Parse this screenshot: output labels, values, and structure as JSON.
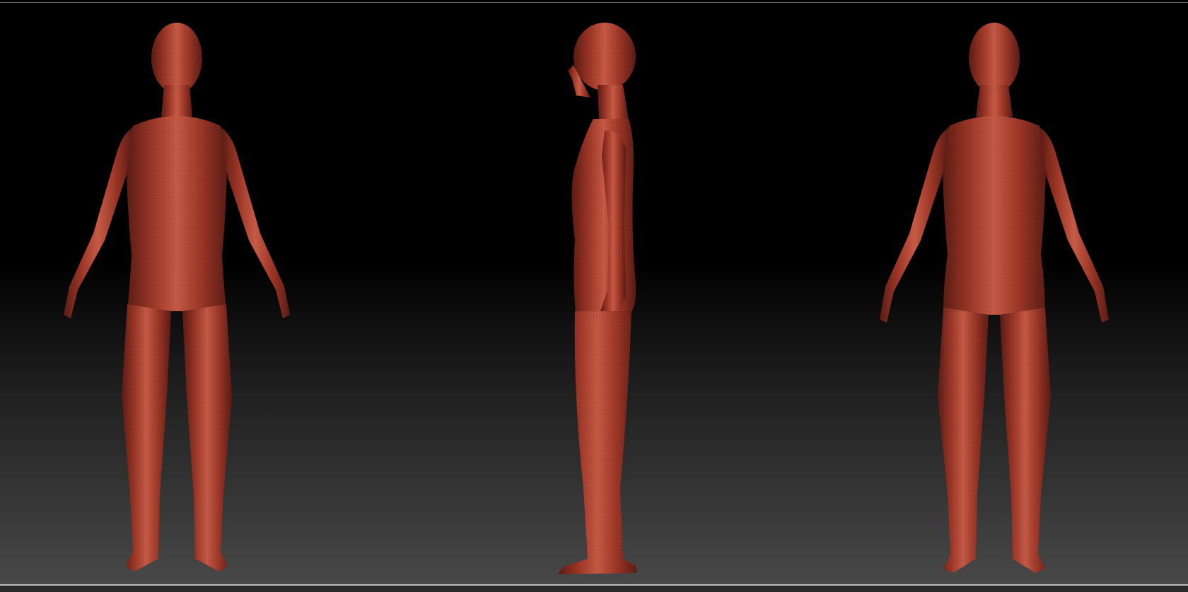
{
  "viewport": {
    "background_top": "#000000",
    "background_bottom": "#4a4a4a"
  },
  "model": {
    "material_color": "#a33a2a",
    "highlight_color": "#c65a45",
    "shadow_color": "#5a1c14",
    "views": [
      "front",
      "side",
      "back"
    ]
  }
}
